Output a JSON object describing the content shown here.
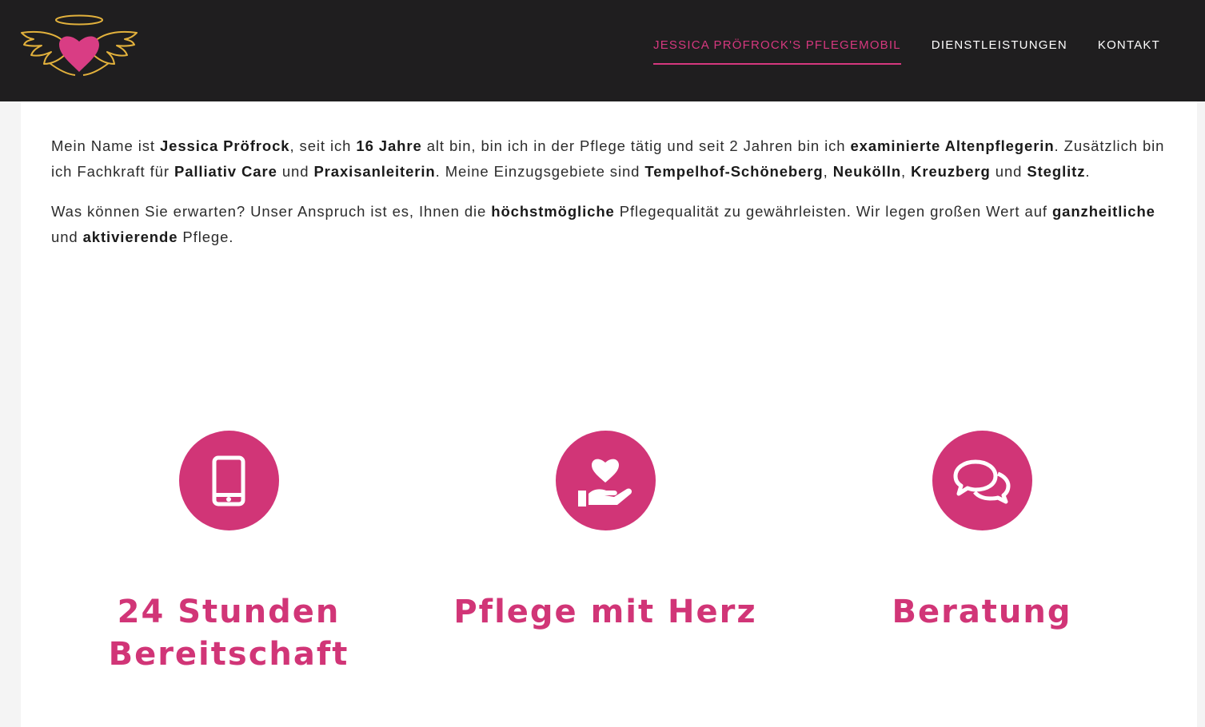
{
  "header": {
    "logo_icon": "heart-with-wings-and-halo-icon",
    "nav": [
      {
        "label": "JESSICA PRÖFROCK'S PFLEGEMOBIL",
        "active": true
      },
      {
        "label": "DIENSTLEISTUNGEN",
        "active": false
      },
      {
        "label": "KONTAKT",
        "active": false
      }
    ]
  },
  "intro": {
    "paragraph1": [
      {
        "t": "Mein Name ist ",
        "b": false
      },
      {
        "t": "Jessica Pröfrock",
        "b": true
      },
      {
        "t": ", seit ich ",
        "b": false
      },
      {
        "t": "16 Jahre",
        "b": true
      },
      {
        "t": " alt bin, bin ich in der Pflege tätig und seit 2 Jahren bin ich ",
        "b": false
      },
      {
        "t": "examinierte Altenpflegerin",
        "b": true
      },
      {
        "t": ". Zusätzlich bin ich Fachkraft für ",
        "b": false
      },
      {
        "t": "Palliativ Care",
        "b": true
      },
      {
        "t": " und ",
        "b": false
      },
      {
        "t": "Praxisanleiterin",
        "b": true
      },
      {
        "t": ". Meine Einzugsgebiete sind ",
        "b": false
      },
      {
        "t": "Tempelhof-Schöneberg",
        "b": true
      },
      {
        "t": ", ",
        "b": false
      },
      {
        "t": "Neukölln",
        "b": true
      },
      {
        "t": ", ",
        "b": false
      },
      {
        "t": "Kreuzberg",
        "b": true
      },
      {
        "t": " und ",
        "b": false
      },
      {
        "t": "Steglitz",
        "b": true
      },
      {
        "t": ".",
        "b": false
      }
    ],
    "paragraph2": [
      {
        "t": "Was können Sie erwarten? Unser Anspruch ist es, Ihnen die ",
        "b": false
      },
      {
        "t": "höchstmögliche",
        "b": true
      },
      {
        "t": " Pflegequalität zu gewährleisten. Wir legen großen Wert auf ",
        "b": false
      },
      {
        "t": "ganzheitliche",
        "b": true
      },
      {
        "t": " und ",
        "b": false
      },
      {
        "t": "aktivierende",
        "b": true
      },
      {
        "t": " Pflege.",
        "b": false
      }
    ]
  },
  "features": [
    {
      "icon": "smartphone-icon",
      "title": "24 Stunden Bereitschaft"
    },
    {
      "icon": "hand-holding-heart-icon",
      "title": "Pflege mit Herz"
    },
    {
      "icon": "chat-bubbles-icon",
      "title": "Beratung"
    }
  ],
  "colors": {
    "accent": "#d13577",
    "header_bg": "#1f1e1f",
    "logo_gold": "#e2b13c"
  }
}
